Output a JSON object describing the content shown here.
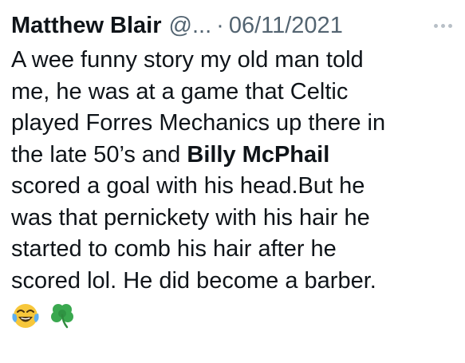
{
  "tweet": {
    "author_name": "Matthew Blair",
    "author_handle": "@...",
    "separator": "·",
    "date": "06/11/2021",
    "lines": [
      "A wee funny story my old man told",
      "me, he was at a game that Celtic",
      "played Forres Mechanics up there in"
    ],
    "line4_pre": "the late 50’s and ",
    "line4_bold": "Billy McPhail",
    "lines_after": [
      "scored a goal with his head.But he",
      "was that pernickety with his hair he",
      "started to comb his hair after he",
      "scored lol. He did become a barber."
    ],
    "emojis": [
      "face-with-tears-of-joy-emoji",
      "shamrock-emoji"
    ]
  },
  "colors": {
    "text": "#0f1419",
    "secondary": "#536471",
    "more_dots": "#b8c0c7",
    "emoji_yellow": "#f7c73b",
    "emoji_tear": "#5fb0f0",
    "shamrock": "#3aa84f"
  }
}
